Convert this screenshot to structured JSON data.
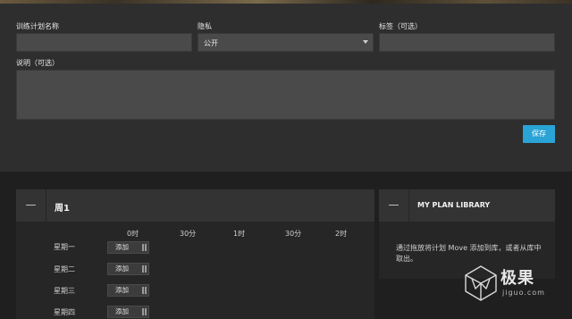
{
  "form": {
    "plan_name_label": "训练计划名称",
    "plan_name_value": "",
    "privacy_label": "隐私",
    "privacy_value": "公开",
    "tags_label": "标签（可选）",
    "tags_value": "",
    "description_label": "说明（可选）",
    "description_value": "",
    "save_label": "保存"
  },
  "week": {
    "collapse_symbol": "—",
    "title": "周1",
    "time_labels": [
      "0时",
      "30分",
      "1时",
      "30分",
      "2时"
    ],
    "add_label": "添加",
    "days": [
      "星期一",
      "星期二",
      "星期三",
      "星期四"
    ]
  },
  "library": {
    "collapse_symbol": "—",
    "title": "MY PLAN LIBRARY",
    "description": "通过拖放将计划 Move 添加到库，或者从库中取出。"
  },
  "watermark": {
    "title": "极果",
    "subtitle": "jiguo.com"
  },
  "colors": {
    "accent": "#2aa3d6",
    "panel": "#2e2e2e",
    "field": "#4a4a4a",
    "background": "#1f1f1f"
  }
}
